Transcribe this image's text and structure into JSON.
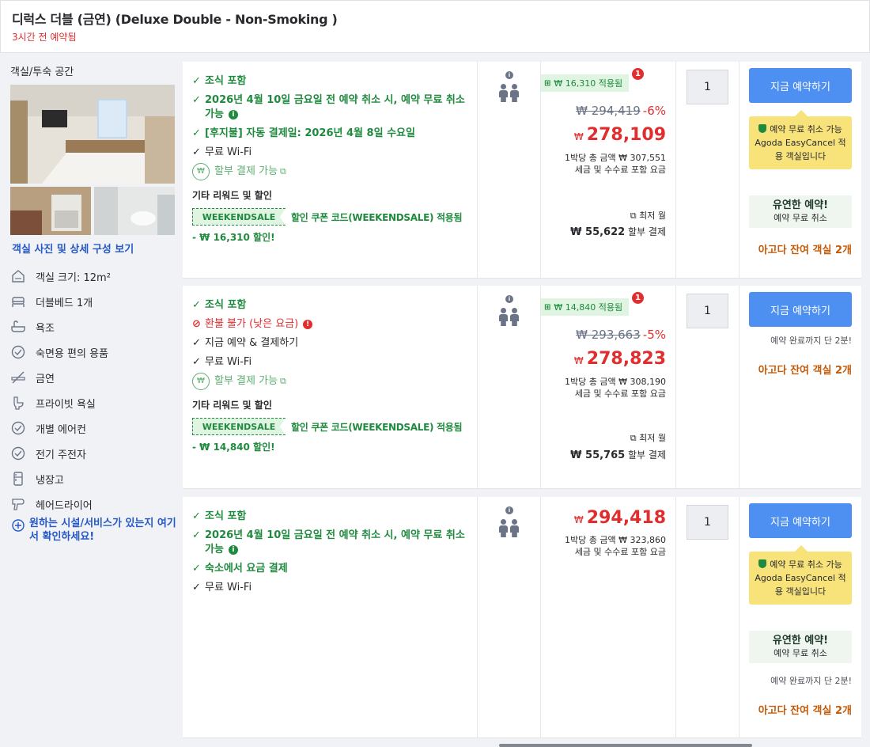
{
  "header": {
    "room_title": "디럭스 더블 (금연) (Deluxe Double - Non-Smoking )",
    "booked_ago": "3시간 전 예약됨"
  },
  "left_panel": {
    "title": "객실/투숙 공간",
    "photos_link": "객실 사진 및 상세 구성 보기",
    "amenities": [
      {
        "icon": "house-icon",
        "label": "객실 크기: 12m²"
      },
      {
        "icon": "bed-icon",
        "label": "더블베드 1개"
      },
      {
        "icon": "bathtub-icon",
        "label": "욕조"
      },
      {
        "icon": "check-circle-icon",
        "label": "숙면용 편의 용품"
      },
      {
        "icon": "no-smoking-icon",
        "label": "금연"
      },
      {
        "icon": "toilet-icon",
        "label": "프라이빗 욕실"
      },
      {
        "icon": "check-circle-icon",
        "label": "개별 에어컨"
      },
      {
        "icon": "check-circle-icon",
        "label": "전기 주전자"
      },
      {
        "icon": "fridge-icon",
        "label": "냉장고"
      },
      {
        "icon": "hair-dryer-icon",
        "label": "헤어드라이어"
      }
    ],
    "more_facilities": "원하는 시설/서비스가 있는지 여기서 확인하세요!"
  },
  "offers": [
    {
      "benefits": {
        "breakfast": "조식 포함",
        "cancel": "2026년 4월 10일 금요일 전 예약 취소 시, 예약 무료 취소 가능",
        "pay_later": "[후지불] 자동 결제일: 2026년 4월 8일 수요일",
        "wifi": "무료 Wi-Fi",
        "installment": "할부 결제 가능"
      },
      "promo": {
        "heading": "기타 리워드 및 할인",
        "coupon": "WEEKENDSALE",
        "coupon_text": "할인 쿠폰 코드(WEEKENDSALE) 적용됨",
        "discount": "- ₩ 16,310 할인!"
      },
      "price": {
        "saved_badge": "₩ 16,310 적용됨",
        "badge_count": "1",
        "original": "₩ 294,419",
        "percent": "-6%",
        "currency": "₩",
        "final": "278,109",
        "total_line1": "1박당 총 금액 ₩ 307,551",
        "total_line2": "세금 및 수수료 포함 요금",
        "monthly_label": "최저 월",
        "monthly_amount": "₩ 55,622",
        "monthly_suffix": "할부 결제"
      },
      "qty": "1",
      "book": {
        "button": "지금 예약하기",
        "easycancel_line1": "예약 무료 취소 가능",
        "easycancel_line2": "Agoda EasyCancel 적용 객실입니다",
        "flex_title": "유연한 예약!",
        "flex_sub": "예약 무료 취소",
        "rooms_left": "아고다 잔여 객실 2개"
      }
    },
    {
      "benefits": {
        "breakfast": "조식 포함",
        "nonrefund": "환불 불가 (낮은 요금)",
        "pay_now": "지금 예약 & 결제하기",
        "wifi": "무료 Wi-Fi",
        "installment": "할부 결제 가능"
      },
      "promo": {
        "heading": "기타 리워드 및 할인",
        "coupon": "WEEKENDSALE",
        "coupon_text": "할인 쿠폰 코드(WEEKENDSALE) 적용됨",
        "discount": "- ₩ 14,840 할인!"
      },
      "price": {
        "saved_badge": "₩ 14,840 적용됨",
        "badge_count": "1",
        "original": "₩ 293,663",
        "percent": "-5%",
        "currency": "₩",
        "final": "278,823",
        "total_line1": "1박당 총 금액 ₩ 308,190",
        "total_line2": "세금 및 수수료 포함 요금",
        "monthly_label": "최저 월",
        "monthly_amount": "₩ 55,765",
        "monthly_suffix": "할부 결제"
      },
      "qty": "1",
      "book": {
        "button": "지금 예약하기",
        "remain_note": "예약 완료까지 단 2분!",
        "rooms_left": "아고다 잔여 객실 2개"
      }
    },
    {
      "benefits": {
        "breakfast": "조식 포함",
        "cancel": "2026년 4월 10일 금요일 전 예약 취소 시, 예약 무료 취소 가능",
        "pay_at_hotel": "숙소에서 요금 결제",
        "wifi": "무료 Wi-Fi"
      },
      "price": {
        "currency": "₩",
        "final": "294,418",
        "total_line1": "1박당 총 금액 ₩ 323,860",
        "total_line2": "세금 및 수수료 포함 요금"
      },
      "qty": "1",
      "book": {
        "button": "지금 예약하기",
        "easycancel_line1": "예약 무료 취소 가능",
        "easycancel_line2": "Agoda EasyCancel 적용 객실입니다",
        "flex_title": "유연한 예약!",
        "flex_sub": "예약 무료 취소",
        "remain_note": "예약 완료까지 단 2분!",
        "rooms_left": "아고다 잔여 객실 2개"
      }
    }
  ]
}
